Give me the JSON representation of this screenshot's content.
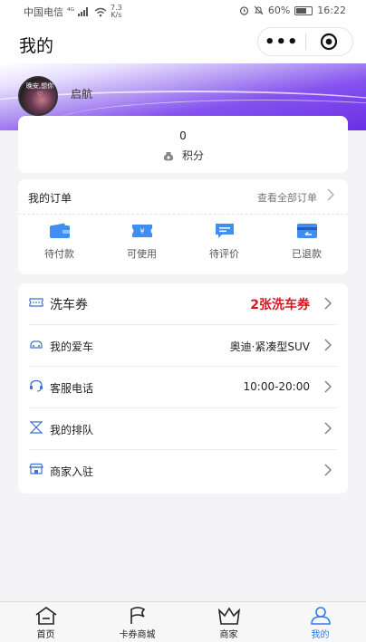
{
  "status_bar": {
    "carrier": "中国电信",
    "network_marks": "⁴ᴳ",
    "speed_value": "7.3",
    "speed_unit": "K/s",
    "battery_percent": "60%",
    "time": "16:22"
  },
  "header": {
    "title": "我的",
    "more_label": "•••"
  },
  "profile": {
    "avatar_text": "晚安,想你 ♡",
    "nickname": "启航"
  },
  "points": {
    "value": "0",
    "label": "积分"
  },
  "orders": {
    "title": "我的订单",
    "view_all": "查看全部订单",
    "items": [
      {
        "label": "待付款",
        "icon": "wallet-icon"
      },
      {
        "label": "可使用",
        "icon": "ticket-icon"
      },
      {
        "label": "待评价",
        "icon": "comment-icon"
      },
      {
        "label": "已退款",
        "icon": "refund-card-icon"
      }
    ]
  },
  "menu": {
    "rows": [
      {
        "label": "洗车券",
        "value": "2张洗车券",
        "icon": "coupon-icon"
      },
      {
        "label": "我的爱车",
        "value": "奥迪·紧凑型SUV",
        "icon": "car-icon"
      },
      {
        "label": "客服电话",
        "value": "10:00-20:00",
        "icon": "headset-icon"
      },
      {
        "label": "我的排队",
        "value": "",
        "icon": "hourglass-icon"
      },
      {
        "label": "商家入驻",
        "value": "",
        "icon": "store-icon"
      }
    ]
  },
  "tabbar": {
    "tabs": [
      {
        "label": "首页",
        "icon": "home-icon"
      },
      {
        "label": "卡券商城",
        "icon": "flag-icon"
      },
      {
        "label": "商家",
        "icon": "crown-basket-icon"
      },
      {
        "label": "我的",
        "icon": "user-icon"
      }
    ],
    "active_index": 3
  },
  "colors": {
    "accent": "#2f7bf0",
    "highlight_red": "#e0111f",
    "banner_purple": "#6a2fe6"
  }
}
